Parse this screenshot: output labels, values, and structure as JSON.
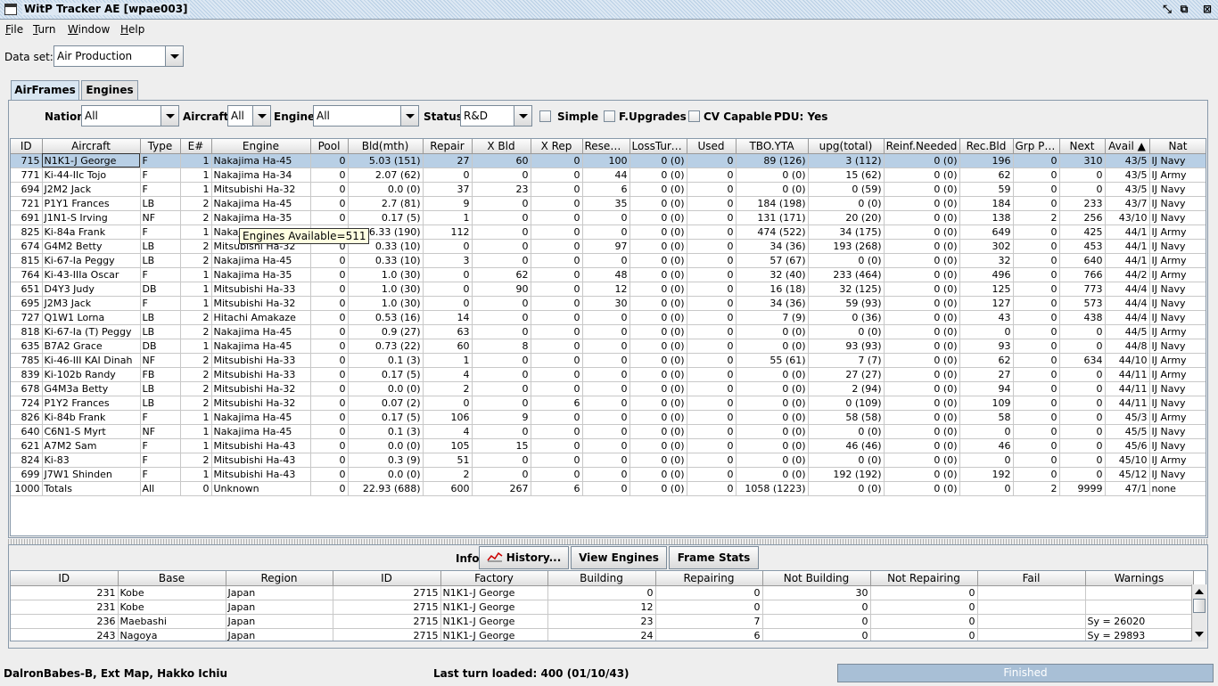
{
  "window": {
    "title": "WitP Tracker AE [wpae003]"
  },
  "menu": [
    {
      "label": "File",
      "u": "F",
      "rest": "ile"
    },
    {
      "label": "Turn",
      "u": "T",
      "rest": "urn"
    },
    {
      "label": "Window",
      "u": "W",
      "rest": "indow"
    },
    {
      "label": "Help",
      "u": "H",
      "rest": "elp"
    }
  ],
  "dataset": {
    "label": "Data set:",
    "value": "Air Production"
  },
  "tabs": [
    "AirFrames",
    "Engines"
  ],
  "filters": {
    "nation_label": "Nation:",
    "nation": "All",
    "aircraft_label": "Aircraft:",
    "aircraft": "All",
    "engine_label": "Engine:",
    "engine": "All",
    "status_label": "Status:",
    "status": "R&D",
    "simple": "Simple",
    "fupgrades": "F.Upgrades",
    "cv": "CV Capable",
    "pdu": "PDU: Yes"
  },
  "main_table": {
    "headers": [
      "ID",
      "Aircraft",
      "Type",
      "E#",
      "Engine",
      "Pool",
      "Bld(mth)",
      "Repair",
      "X Bld",
      "X Rep",
      "Resear...",
      "LossTurn...",
      "Used",
      "TBO.YTA",
      "upg(total)",
      "Reinf.Needed",
      "Rec.Bld",
      "Grp Pla...",
      "Next",
      "Avail ▲",
      "Nat"
    ],
    "rows": [
      [
        "715",
        "N1K1-J George",
        "F",
        "1",
        "Nakajima Ha-45",
        "0",
        "5.03 (151)",
        "27",
        "60",
        "0",
        "100",
        "0 (0)",
        "0",
        "89 (126)",
        "3 (112)",
        "0 (0)",
        "196",
        "0",
        "310",
        "43/5",
        "IJ Navy"
      ],
      [
        "771",
        "Ki-44-IIc Tojo",
        "F",
        "1",
        "Nakajima Ha-34",
        "0",
        "2.07 (62)",
        "0",
        "0",
        "0",
        "44",
        "0 (0)",
        "0",
        "0 (0)",
        "15 (62)",
        "0 (0)",
        "62",
        "0",
        "0",
        "43/5",
        "IJ Army"
      ],
      [
        "694",
        "J2M2 Jack",
        "F",
        "1",
        "Mitsubishi Ha-32",
        "0",
        "0.0 (0)",
        "37",
        "23",
        "0",
        "6",
        "0 (0)",
        "0",
        "0 (0)",
        "0 (59)",
        "0 (0)",
        "59",
        "0",
        "0",
        "43/5",
        "IJ Navy"
      ],
      [
        "721",
        "P1Y1 Frances",
        "LB",
        "2",
        "Nakajima Ha-45",
        "0",
        "2.7 (81)",
        "9",
        "0",
        "0",
        "35",
        "0 (0)",
        "0",
        "184 (198)",
        "0 (0)",
        "0 (0)",
        "184",
        "0",
        "233",
        "43/7",
        "IJ Navy"
      ],
      [
        "691",
        "J1N1-S Irving",
        "NF",
        "2",
        "Nakajima Ha-35",
        "0",
        "0.17 (5)",
        "1",
        "0",
        "0",
        "0",
        "0 (0)",
        "0",
        "131 (171)",
        "20 (20)",
        "0 (0)",
        "138",
        "2",
        "256",
        "43/10",
        "IJ Navy"
      ],
      [
        "825",
        "Ki-84a Frank",
        "F",
        "1",
        "Nakajima Ha-45",
        "0",
        "6.33 (190)",
        "112",
        "0",
        "0",
        "0",
        "0 (0)",
        "0",
        "474 (522)",
        "34 (175)",
        "0 (0)",
        "649",
        "0",
        "425",
        "44/1",
        "IJ Army"
      ],
      [
        "674",
        "G4M2 Betty",
        "LB",
        "2",
        "Mitsubishi Ha-32",
        "0",
        "0.33 (10)",
        "0",
        "0",
        "0",
        "97",
        "0 (0)",
        "0",
        "34 (36)",
        "193 (268)",
        "0 (0)",
        "302",
        "0",
        "453",
        "44/1",
        "IJ Navy"
      ],
      [
        "815",
        "Ki-67-Ia Peggy",
        "LB",
        "2",
        "Nakajima Ha-45",
        "0",
        "0.33 (10)",
        "3",
        "0",
        "0",
        "0",
        "0 (0)",
        "0",
        "57 (67)",
        "0 (0)",
        "0 (0)",
        "32",
        "0",
        "640",
        "44/1",
        "IJ Army"
      ],
      [
        "764",
        "Ki-43-IIIa Oscar",
        "F",
        "1",
        "Nakajima Ha-35",
        "0",
        "1.0 (30)",
        "0",
        "62",
        "0",
        "48",
        "0 (0)",
        "0",
        "32 (40)",
        "233 (464)",
        "0 (0)",
        "496",
        "0",
        "766",
        "44/2",
        "IJ Army"
      ],
      [
        "651",
        "D4Y3 Judy",
        "DB",
        "1",
        "Mitsubishi Ha-33",
        "0",
        "1.0 (30)",
        "0",
        "90",
        "0",
        "12",
        "0 (0)",
        "0",
        "16 (18)",
        "32 (125)",
        "0 (0)",
        "125",
        "0",
        "773",
        "44/4",
        "IJ Navy"
      ],
      [
        "695",
        "J2M3 Jack",
        "F",
        "1",
        "Mitsubishi Ha-32",
        "0",
        "1.0 (30)",
        "0",
        "0",
        "0",
        "30",
        "0 (0)",
        "0",
        "34 (36)",
        "59 (93)",
        "0 (0)",
        "127",
        "0",
        "573",
        "44/4",
        "IJ Navy"
      ],
      [
        "727",
        "Q1W1 Lorna",
        "LB",
        "2",
        "Hitachi Amakaze",
        "0",
        "0.53 (16)",
        "14",
        "0",
        "0",
        "0",
        "0 (0)",
        "0",
        "7 (9)",
        "0 (36)",
        "0 (0)",
        "43",
        "0",
        "438",
        "44/4",
        "IJ Navy"
      ],
      [
        "818",
        "Ki-67-Ia (T) Peggy",
        "LB",
        "2",
        "Nakajima Ha-45",
        "0",
        "0.9 (27)",
        "63",
        "0",
        "0",
        "0",
        "0 (0)",
        "0",
        "0 (0)",
        "0 (0)",
        "0 (0)",
        "0",
        "0",
        "0",
        "44/5",
        "IJ Army"
      ],
      [
        "635",
        "B7A2 Grace",
        "DB",
        "1",
        "Nakajima Ha-45",
        "0",
        "0.73 (22)",
        "60",
        "8",
        "0",
        "0",
        "0 (0)",
        "0",
        "0 (0)",
        "93 (93)",
        "0 (0)",
        "93",
        "0",
        "0",
        "44/8",
        "IJ Navy"
      ],
      [
        "785",
        "Ki-46-III KAI Dinah",
        "NF",
        "2",
        "Mitsubishi Ha-33",
        "0",
        "0.1 (3)",
        "1",
        "0",
        "0",
        "0",
        "0 (0)",
        "0",
        "55 (61)",
        "7 (7)",
        "0 (0)",
        "62",
        "0",
        "634",
        "44/10",
        "IJ Army"
      ],
      [
        "839",
        "Ki-102b Randy",
        "FB",
        "2",
        "Mitsubishi Ha-33",
        "0",
        "0.17 (5)",
        "4",
        "0",
        "0",
        "0",
        "0 (0)",
        "0",
        "0 (0)",
        "27 (27)",
        "0 (0)",
        "27",
        "0",
        "0",
        "44/11",
        "IJ Army"
      ],
      [
        "678",
        "G4M3a Betty",
        "LB",
        "2",
        "Mitsubishi Ha-32",
        "0",
        "0.0 (0)",
        "2",
        "0",
        "0",
        "0",
        "0 (0)",
        "0",
        "0 (0)",
        "2 (94)",
        "0 (0)",
        "94",
        "0",
        "0",
        "44/11",
        "IJ Navy"
      ],
      [
        "724",
        "P1Y2 Frances",
        "LB",
        "2",
        "Mitsubishi Ha-32",
        "0",
        "0.07 (2)",
        "0",
        "0",
        "6",
        "0",
        "0 (0)",
        "0",
        "0 (0)",
        "0 (109)",
        "0 (0)",
        "109",
        "0",
        "0",
        "44/11",
        "IJ Navy"
      ],
      [
        "826",
        "Ki-84b Frank",
        "F",
        "1",
        "Nakajima Ha-45",
        "0",
        "0.17 (5)",
        "106",
        "9",
        "0",
        "0",
        "0 (0)",
        "0",
        "0 (0)",
        "58 (58)",
        "0 (0)",
        "58",
        "0",
        "0",
        "45/3",
        "IJ Army"
      ],
      [
        "640",
        "C6N1-S Myrt",
        "NF",
        "1",
        "Nakajima Ha-45",
        "0",
        "0.1 (3)",
        "4",
        "0",
        "0",
        "0",
        "0 (0)",
        "0",
        "0 (0)",
        "0 (0)",
        "0 (0)",
        "0",
        "0",
        "0",
        "45/5",
        "IJ Navy"
      ],
      [
        "621",
        "A7M2 Sam",
        "F",
        "1",
        "Mitsubishi Ha-43",
        "0",
        "0.0 (0)",
        "105",
        "15",
        "0",
        "0",
        "0 (0)",
        "0",
        "0 (0)",
        "46 (46)",
        "0 (0)",
        "46",
        "0",
        "0",
        "45/6",
        "IJ Navy"
      ],
      [
        "824",
        "Ki-83",
        "F",
        "2",
        "Mitsubishi Ha-43",
        "0",
        "0.3 (9)",
        "51",
        "0",
        "0",
        "0",
        "0 (0)",
        "0",
        "0 (0)",
        "0 (0)",
        "0 (0)",
        "0",
        "0",
        "0",
        "45/10",
        "IJ Army"
      ],
      [
        "699",
        "J7W1 Shinden",
        "F",
        "1",
        "Mitsubishi Ha-43",
        "0",
        "0.0 (0)",
        "2",
        "0",
        "0",
        "0",
        "0 (0)",
        "0",
        "0 (0)",
        "192 (192)",
        "0 (0)",
        "192",
        "0",
        "0",
        "45/12",
        "IJ Navy"
      ],
      [
        "1000",
        "Totals",
        "All",
        "0",
        "Unknown",
        "0",
        "22.93 (688)",
        "600",
        "267",
        "6",
        "0",
        "0 (0)",
        "0",
        "1058 (1223)",
        "0 (0)",
        "0 (0)",
        "0",
        "2",
        "9999",
        "47/1",
        "none"
      ]
    ]
  },
  "tooltip": "Engines Available=511",
  "info": {
    "label": "Info:",
    "history": "History...",
    "view_engines": "View Engines",
    "frame_stats": "Frame Stats"
  },
  "lower_table": {
    "headers": [
      "ID",
      "Base",
      "Region",
      "ID",
      "Factory",
      "Building",
      "Repairing",
      "Not Building",
      "Not Repairing",
      "Fail",
      "Warnings"
    ],
    "rows": [
      [
        "231",
        "Kobe",
        "Japan",
        "2715",
        "N1K1-J George",
        "0",
        "0",
        "30",
        "0",
        "",
        ""
      ],
      [
        "231",
        "Kobe",
        "Japan",
        "2715",
        "N1K1-J George",
        "12",
        "0",
        "0",
        "0",
        "",
        ""
      ],
      [
        "236",
        "Maebashi",
        "Japan",
        "2715",
        "N1K1-J George",
        "23",
        "7",
        "0",
        "0",
        "",
        "Sy = 26020"
      ],
      [
        "243",
        "Nagoya",
        "Japan",
        "2715",
        "N1K1-J George",
        "24",
        "6",
        "0",
        "0",
        "",
        "Sy = 29893"
      ]
    ]
  },
  "status": {
    "left": "DalronBabes-B, Ext Map, Hakko Ichiu",
    "center": "Last turn loaded: 400 (01/10/43)",
    "progress": "Finished"
  }
}
